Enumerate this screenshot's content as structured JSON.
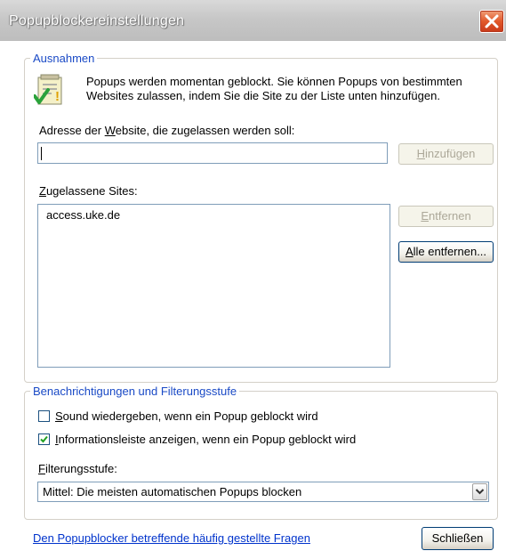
{
  "window": {
    "title": "Popupblockereinstellungen"
  },
  "exceptions": {
    "group_label": "Ausnahmen",
    "info_line1": "Popups werden momentan geblockt. Sie können Popups von bestimmten",
    "info_line2": "Websites zulassen, indem Sie die Site zu der Liste unten hinzufügen.",
    "address_label_pre": "Adresse der ",
    "address_label_key": "W",
    "address_label_post": "ebsite, die zugelassen werden soll:",
    "address_value": "",
    "add_button_key": "H",
    "add_button_rest": "inzufügen",
    "sites_label_key": "Z",
    "sites_label_rest": "ugelassene Sites:",
    "sites": [
      "access.uke.de"
    ],
    "remove_button_key": "E",
    "remove_button_rest": "ntfernen",
    "remove_all_key": "A",
    "remove_all_rest": "lle entfernen..."
  },
  "notifications": {
    "group_label": "Benachrichtigungen und Filterungsstufe",
    "sound_key": "S",
    "sound_rest": "ound wiedergeben, wenn ein Popup geblockt wird",
    "sound_checked": false,
    "infobar_key": "I",
    "infobar_rest": "nformationsleiste anzeigen, wenn ein Popup geblockt wird",
    "infobar_checked": true,
    "filter_label_key": "F",
    "filter_label_rest": "ilterungsstufe:",
    "filter_value": "Mittel: Die meisten automatischen Popups blocken"
  },
  "footer": {
    "faq_link": "Den Popupblocker betreffende häufig gestellte Fragen",
    "close_button": "Schließen"
  },
  "icons": {
    "title_close": "close-icon",
    "info": "checklist-info-icon",
    "dropdown": "chevron-down-icon",
    "check": "checkmark-icon"
  }
}
